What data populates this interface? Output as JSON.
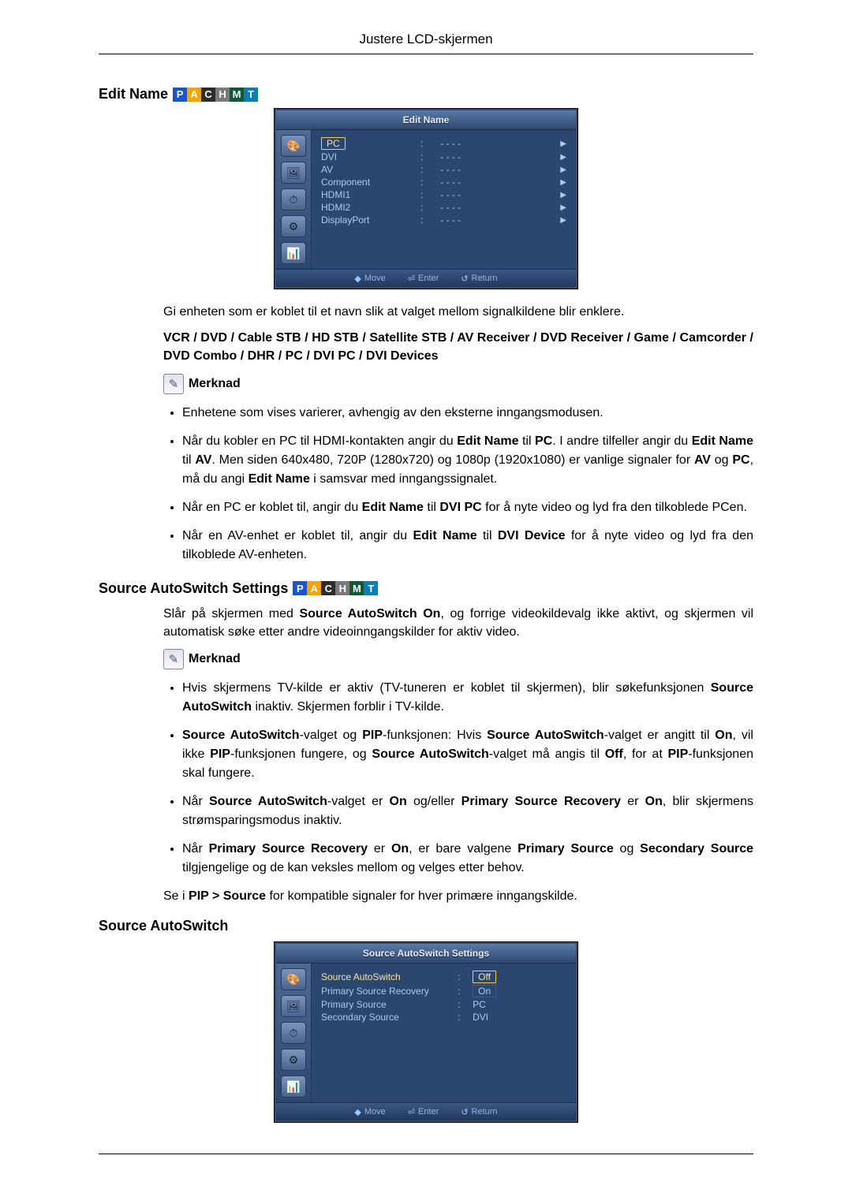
{
  "header": {
    "title": "Justere LCD-skjermen"
  },
  "tags": [
    "P",
    "A",
    "C",
    "H",
    "M",
    "T"
  ],
  "sections": {
    "editName": {
      "heading": "Edit Name",
      "osd": {
        "title": "Edit Name",
        "rows": [
          {
            "label": "PC",
            "sep": ":",
            "val": "- - - -"
          },
          {
            "label": "DVI",
            "sep": ":",
            "val": "- - - -"
          },
          {
            "label": "AV",
            "sep": ":",
            "val": "- - - -"
          },
          {
            "label": "Component",
            "sep": ":",
            "val": "- - - -"
          },
          {
            "label": "HDMI1",
            "sep": ":",
            "val": "- - - -"
          },
          {
            "label": "HDMI2",
            "sep": ":",
            "val": "- - - -"
          },
          {
            "label": "DisplayPort",
            "sep": ":",
            "val": "- - - -"
          }
        ],
        "footer": {
          "move": "Move",
          "enter": "Enter",
          "return": "Return"
        }
      },
      "intro": "Gi enheten som er koblet til et navn slik at valget mellom signalkildene blir enklere.",
      "bold_line": "VCR / DVD / Cable STB / HD STB / Satellite STB / AV Receiver / DVD Receiver / Game / Camcorder / DVD Combo / DHR / PC / DVI PC / DVI Devices",
      "note_label": "Merknad",
      "bullets": [
        {
          "text": "Enhetene som vises varierer, avhengig av den eksterne inngangsmodusen."
        },
        {
          "pre": "Når du kobler en PC til HDMI-kontakten angir du ",
          "b1": "Edit Name",
          "mid1": " til ",
          "b2": "PC",
          "mid2": ". I andre tilfeller angir du ",
          "b3": "Edit Name",
          "mid3": " til ",
          "b4": "AV",
          "mid4": ". Men siden 640x480, 720P (1280x720) og 1080p (1920x1080) er vanlige signaler for ",
          "b5": "AV",
          "mid5": " og ",
          "b6": "PC",
          "mid6": ", må du angi ",
          "b7": "Edit Name",
          "post": " i samsvar med inngangssignalet."
        },
        {
          "pre": "Når en PC er koblet til, angir du ",
          "b1": "Edit Name",
          "mid1": " til ",
          "b2": "DVI PC",
          "post": " for å nyte video og lyd fra den tilkoblede PCen."
        },
        {
          "pre": "Når en AV-enhet er koblet til, angir du ",
          "b1": "Edit Name",
          "mid1": " til ",
          "b2": "DVI Device",
          "post": " for å nyte video og lyd fra den tilkoblede AV-enheten."
        }
      ]
    },
    "sasSettings": {
      "heading": "Source AutoSwitch Settings",
      "intro_pre": "Slår på skjermen med ",
      "intro_b1": "Source AutoSwitch On",
      "intro_post": ", og forrige videokildevalg ikke aktivt, og skjermen vil automatisk søke etter andre videoinngangskilder for aktiv video.",
      "note_label": "Merknad",
      "bullets": [
        {
          "pre": "Hvis skjermens TV-kilde er aktiv (TV-tuneren er koblet til skjermen), blir søkefunksjonen ",
          "b1": "Source AutoSwitch",
          "post": " inaktiv. Skjermen forblir i TV-kilde."
        },
        {
          "b0": "Source AutoSwitch",
          "m0": "-valget og ",
          "b1": "PIP",
          "m1": "-funksjonen: Hvis ",
          "b2": "Source AutoSwitch",
          "m2": "-valget er angitt til ",
          "b3": "On",
          "m3": ", vil ikke ",
          "b4": "PIP",
          "m4": "-funksjonen fungere, og ",
          "b5": "Source AutoSwitch",
          "m5": "-valget må angis til ",
          "b6": "Off",
          "m6": ", for at ",
          "b7": "PIP",
          "m7": "-funksjonen skal fungere."
        },
        {
          "pre": "Når ",
          "b1": "Source AutoSwitch",
          "m1": "-valget er ",
          "b2": "On",
          "m2": " og/eller ",
          "b3": "Primary Source Recovery",
          "m3": " er ",
          "b4": "On",
          "post": ", blir skjermens strømsparingsmodus inaktiv."
        },
        {
          "pre": "Når ",
          "b1": "Primary Source Recovery",
          "m1": " er ",
          "b2": "On",
          "m2": ", er bare valgene ",
          "b3": "Primary Source",
          "m3": " og ",
          "b4": "Secondary Source",
          "post": " tilgjengelige og de kan veksles mellom og velges etter behov."
        }
      ],
      "tail_pre": "Se i ",
      "tail_b": "PIP > Source",
      "tail_post": " for kompatible signaler for hver primære inngangskilde."
    },
    "sas": {
      "heading": "Source AutoSwitch",
      "osd": {
        "title": "Source AutoSwitch Settings",
        "rows": [
          {
            "label": "Source AutoSwitch",
            "sep": ":",
            "val": "Off",
            "hl_label": true,
            "boxed": true
          },
          {
            "label": "Primary Source Recovery",
            "sep": ":",
            "val": "On",
            "dim": true,
            "boxed": true
          },
          {
            "label": "Primary Source",
            "sep": ":",
            "val": "PC",
            "dim": true
          },
          {
            "label": "Secondary Source",
            "sep": ":",
            "val": "DVI",
            "dim": true
          }
        ],
        "footer": {
          "move": "Move",
          "enter": "Enter",
          "return": "Return"
        }
      }
    }
  }
}
